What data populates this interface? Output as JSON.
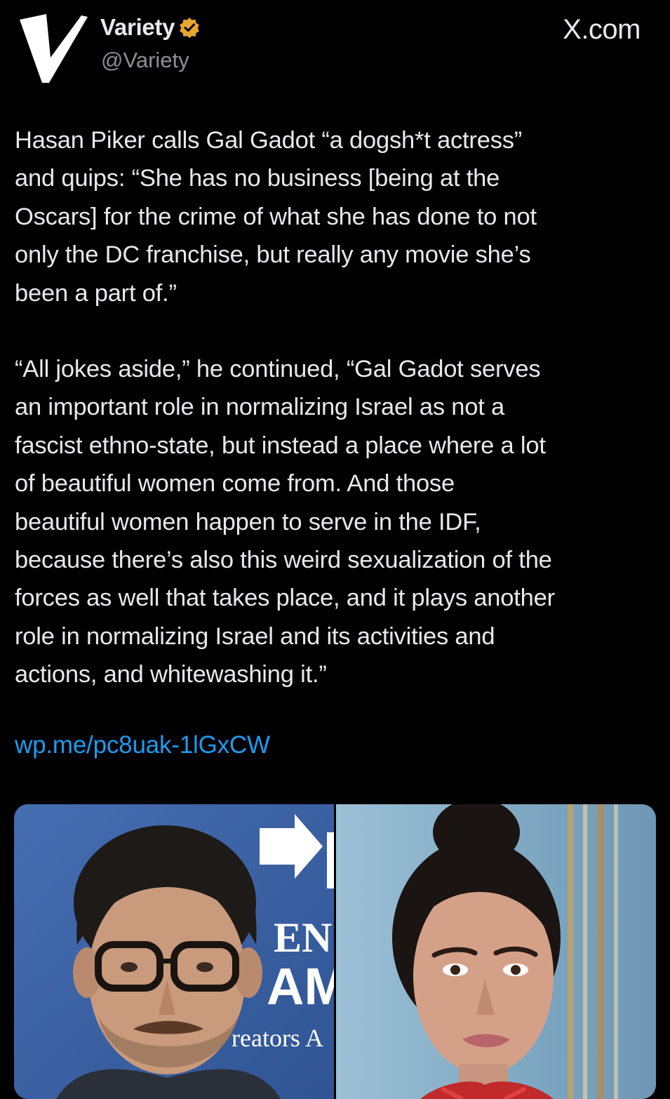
{
  "header": {
    "display_name": "Variety",
    "handle": "@Variety",
    "verified_badge": "verified-badge-icon",
    "source": "X.com"
  },
  "tweet": {
    "paragraph_1": "Hasan Piker calls Gal Gadot “a dogsh*t actress”\nand quips: “She has no business [being at the\nOscars] for the crime of what she has done to not\nonly the DC franchise, but really any movie she’s\nbeen a part of.”",
    "paragraph_2": "“All jokes aside,” he continued, “Gal Gadot serves\nan important role in normalizing Israel as not a\nfascist ethno-state, but instead a place where a lot\nof beautiful women come from. And those\nbeautiful women happen to serve in the IDF,\nbecause there’s also this weird sexualization of the\nforces as well that takes place, and it plays another\nrole in normalizing Israel and its activities and\nactions, and whitewashing it.”",
    "link": "wp.me/pc8uak-1lGxCW"
  },
  "media": {
    "backdrop_text": [
      "EN",
      "AM",
      "reators A"
    ],
    "colors": {
      "left_bg": "#3e64a8",
      "right_bg": "#8fb3c9",
      "link": "#1d9bf0",
      "badge": "#e8a72e"
    }
  }
}
